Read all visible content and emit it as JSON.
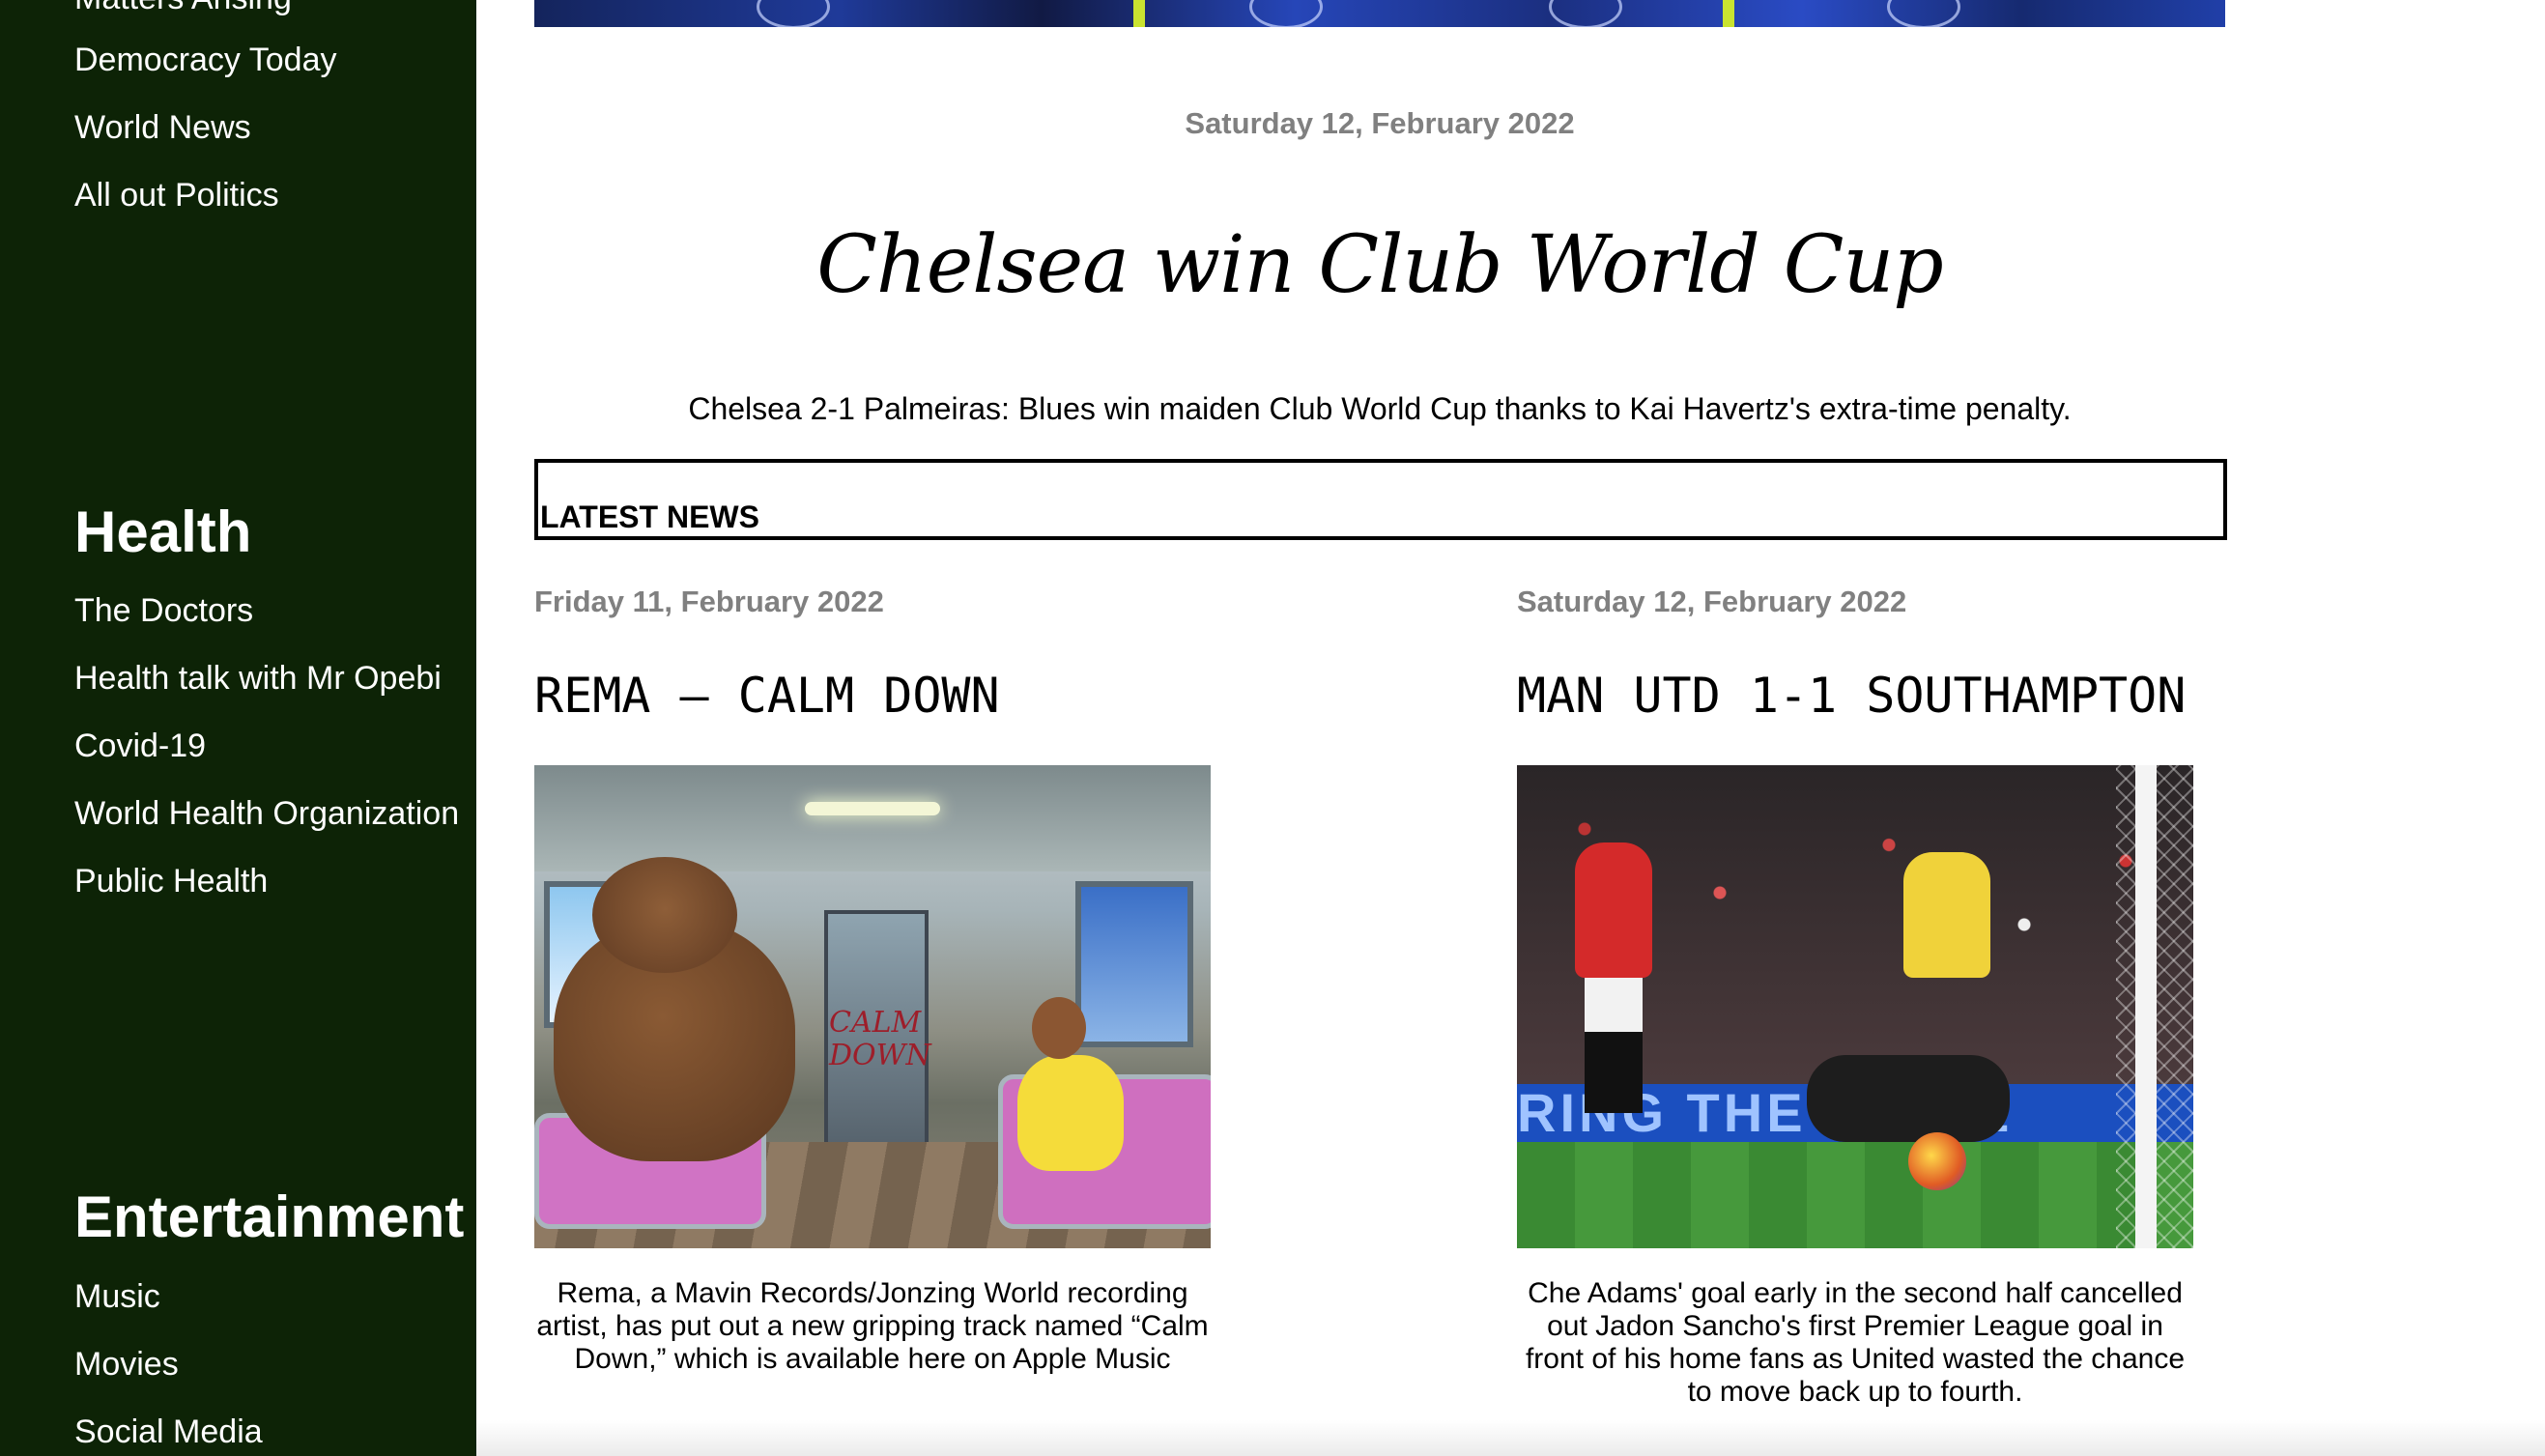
{
  "sidebar": {
    "top_links": [
      {
        "label": "Matters Arising"
      },
      {
        "label": "Democracy Today"
      },
      {
        "label": "World News"
      },
      {
        "label": "All out Politics"
      }
    ],
    "health": {
      "heading": "Health",
      "links": [
        {
          "label": "The Doctors"
        },
        {
          "label": "Health talk with Mr Opebi"
        },
        {
          "label": "Covid-19"
        },
        {
          "label": "World Health Organization"
        },
        {
          "label": "Public Health"
        }
      ]
    },
    "entertainment": {
      "heading": "Entertainment",
      "links": [
        {
          "label": "Music"
        },
        {
          "label": "Movies"
        },
        {
          "label": "Social Media"
        }
      ]
    }
  },
  "feature": {
    "date": "Saturday 12, February 2022",
    "headline": "Chelsea win Club World Cup",
    "summary": "Chelsea 2-1 Palmeiras: Blues win maiden Club World Cup thanks to Kai Havertz's extra-time penalty."
  },
  "latest_news": {
    "label": "LATEST NEWS",
    "articles": [
      {
        "date": "Friday 11, February 2022",
        "title": "REMA – CALM DOWN",
        "image_text": "CALM DOWN",
        "caption": "Rema, a Mavin Records/Jonzing World recording artist, has put out a new gripping track named “Calm Down,” which is available here on Apple Music"
      },
      {
        "date": "Saturday 12, February 2022",
        "title": "MAN UTD 1-1 SOUTHAMPTON",
        "image_text": "RING THE NOISE",
        "caption": "Che Adams' goal early in the second half cancelled out Jadon Sancho's first Premier League goal in front of his home fans as United wasted the chance to move back up to fourth."
      }
    ]
  },
  "colors": {
    "sidebar_bg": "#0d2306",
    "date_gray": "#808080",
    "text": "#000000"
  }
}
